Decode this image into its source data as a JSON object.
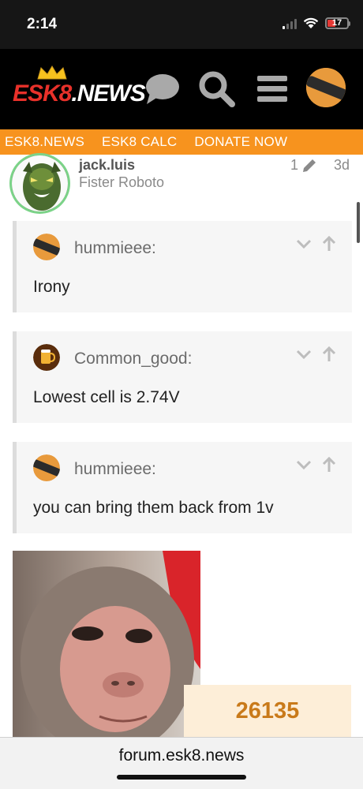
{
  "status_bar": {
    "time": "2:14",
    "battery_level": "17",
    "signal_bars_active": 1
  },
  "header": {
    "logo_text_a": "ESK8",
    "logo_text_b": ".NEWS",
    "icons": [
      "chat-icon",
      "search-icon",
      "hamburger-menu-icon",
      "user-avatar"
    ],
    "colors": {
      "background": "#000000",
      "icon": "#a9a9a9",
      "accent": "#f7931e"
    }
  },
  "nav": {
    "items": [
      "ESK8.NEWS",
      "ESK8 CALC",
      "DONATE NOW"
    ],
    "background": "#f7931e"
  },
  "post": {
    "username": "jack.luis",
    "user_title": "Fister Roboto",
    "edit_count": "1",
    "age": "3d",
    "quotes": [
      {
        "user": "hummieee:",
        "text": "Irony"
      },
      {
        "user": "Common_good:",
        "text": "Lowest cell is 2.74V"
      },
      {
        "user": "hummieee:",
        "text": "you can bring them back from 1v"
      }
    ]
  },
  "counter": {
    "value": "26135"
  },
  "browser": {
    "url": "forum.esk8.news"
  }
}
